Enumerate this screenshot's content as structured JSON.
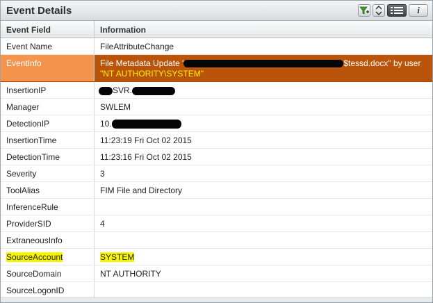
{
  "panel": {
    "title": "Event Details",
    "toolbar": [
      "filter-add-icon",
      "sort-updown-icon",
      "list-view-icon",
      "info-icon"
    ],
    "info_label": "i"
  },
  "table": {
    "headers": [
      "Event Field",
      "Information"
    ],
    "rows": [
      {
        "field": "Event Name",
        "info": "FileAttributeChange"
      },
      {
        "field": "EventInfo",
        "info_line1_prefix": "File Metadata Update '",
        "info_line1_suffix": "$tessd.docx\" by user",
        "info_line2": "\"NT AUTHORITY\\SYSTEM\""
      },
      {
        "field": "InsertionIP",
        "info": "SVR."
      },
      {
        "field": "Manager",
        "info": "SWLEM"
      },
      {
        "field": "DetectionIP",
        "info": "10."
      },
      {
        "field": "InsertionTime",
        "info": "11:23:19 Fri Oct 02 2015"
      },
      {
        "field": "DetectionTime",
        "info": "11:23:16 Fri Oct 02 2015"
      },
      {
        "field": "Severity",
        "info": "3"
      },
      {
        "field": "ToolAlias",
        "info": "FIM File and Directory"
      },
      {
        "field": "InferenceRule",
        "info": ""
      },
      {
        "field": "ProviderSID",
        "info": "4"
      },
      {
        "field": "ExtraneousInfo",
        "info": ""
      },
      {
        "field": "SourceAccount",
        "info": "SYSTEM"
      },
      {
        "field": "SourceDomain",
        "info": "NT AUTHORITY"
      },
      {
        "field": "SourceLogonID",
        "info": ""
      }
    ]
  },
  "colors": {
    "selected_field_bg": "#f5944c",
    "selected_info_bg": "#b9540a",
    "highlight": "#f7f500"
  }
}
